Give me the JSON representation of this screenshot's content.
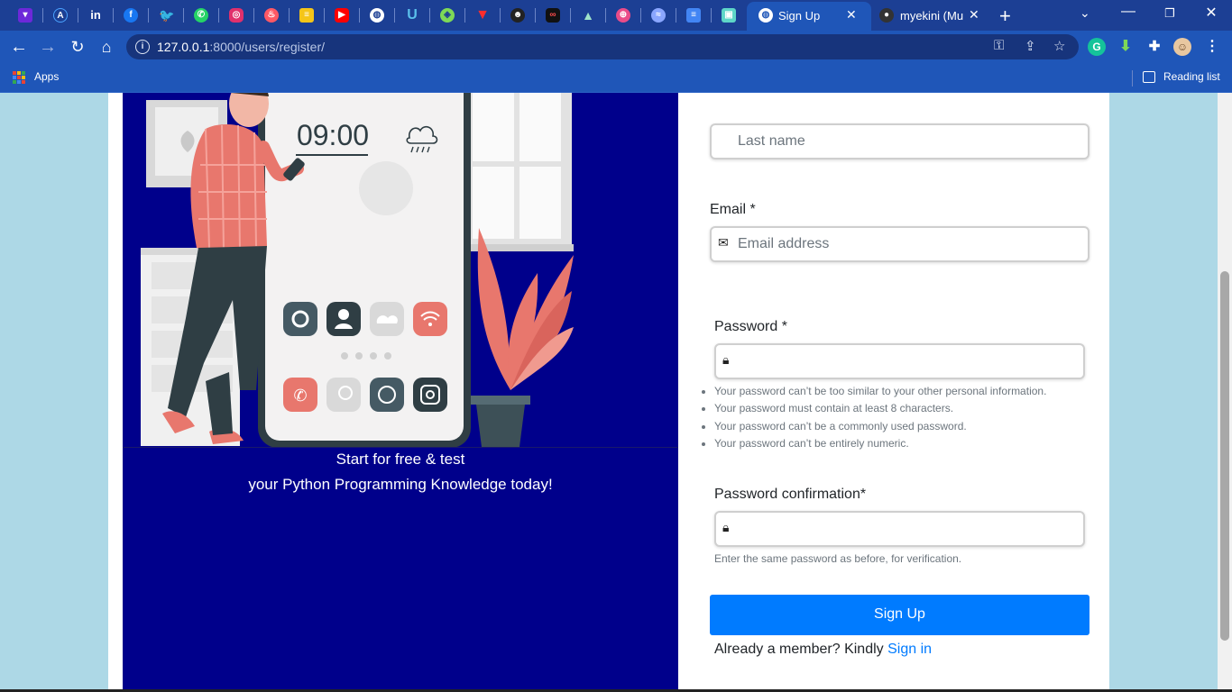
{
  "browser": {
    "tabs": [
      {
        "title": "Sign Up",
        "active": true
      },
      {
        "title": "myekini (Muh",
        "active": false
      }
    ],
    "pinned_tab_icons": [
      "mail-icon",
      "globe-icon",
      "linkedin-icon",
      "facebook-icon",
      "twitter-icon",
      "whatsapp-icon",
      "instagram-icon",
      "tinder-icon",
      "notes-icon",
      "youtube-icon",
      "world-icon",
      "upwork-icon",
      "codepen-icon",
      "vercel-icon",
      "github-avatar-icon",
      "colab-icon",
      "mountain-icon",
      "dribbble-icon",
      "wave-icon",
      "docs-icon",
      "image-icon"
    ],
    "url_host": "127.0.0.1",
    "url_rest": ":8000/users/register/",
    "bookmarks": {
      "apps_label": "Apps",
      "reading_list_label": "Reading list"
    }
  },
  "hero": {
    "clock": "09:00",
    "tagline_line1": "Start for free & test",
    "tagline_line2": "your Python Programming Knowledge today!"
  },
  "form": {
    "last_name_placeholder": "Last name",
    "email_label": "Email *",
    "email_placeholder": "Email address",
    "password_label": "Password *",
    "password_help": [
      "Your password can’t be too similar to your other personal information.",
      "Your password must contain at least 8 characters.",
      "Your password can’t be a commonly used password.",
      "Your password can’t be entirely numeric."
    ],
    "password_confirm_label": "Password confirmation*",
    "password_confirm_help": "Enter the same password as before, for verification.",
    "submit_label": "Sign Up",
    "signin_prompt": "Already a member? Kindly ",
    "signin_link": "Sign in"
  }
}
